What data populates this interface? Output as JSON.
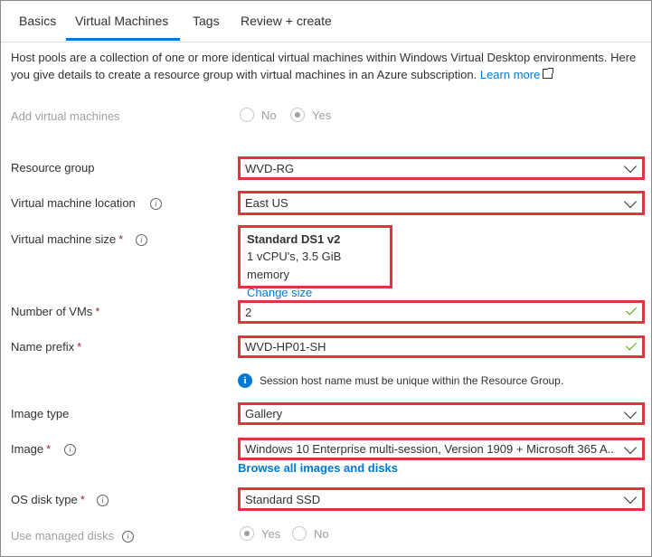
{
  "tabs": [
    {
      "label": "Basics"
    },
    {
      "label": "Virtual Machines"
    },
    {
      "label": "Tags"
    },
    {
      "label": "Review + create"
    }
  ],
  "description": {
    "text": "Host pools are a collection of one or more identical virtual machines within Windows Virtual Desktop environments. Here you give details to create a resource group with virtual machines in an Azure subscription.",
    "link": "Learn more"
  },
  "add_vms": {
    "label": "Add virtual machines",
    "option_no": "No",
    "option_yes": "Yes",
    "selected": "Yes"
  },
  "resource_group": {
    "label": "Resource group",
    "value": "WVD-RG"
  },
  "vm_location": {
    "label": "Virtual machine location",
    "value": "East US"
  },
  "vm_size": {
    "label": "Virtual machine size",
    "name": "Standard DS1 v2",
    "specs": "1 vCPU's, 3.5 GiB memory",
    "change_link": "Change size"
  },
  "num_vms": {
    "label": "Number of VMs",
    "value": "2"
  },
  "name_prefix": {
    "label": "Name prefix",
    "value": "WVD-HP01-SH"
  },
  "session_info": "Session host name must be unique within the Resource Group.",
  "image_type": {
    "label": "Image type",
    "value": "Gallery"
  },
  "image": {
    "label": "Image",
    "value": "Windows 10 Enterprise multi-session, Version 1909 + Microsoft 365 A...",
    "browse_link": "Browse all images and disks"
  },
  "os_disk": {
    "label": "OS disk type",
    "value": "Standard SSD"
  },
  "managed_disks": {
    "label": "Use managed disks",
    "option_yes": "Yes",
    "option_no": "No",
    "selected": "Yes"
  },
  "required_marker": "*",
  "colors": {
    "accent": "#0078d4",
    "highlight": "#e03440",
    "valid": "#57a300"
  }
}
